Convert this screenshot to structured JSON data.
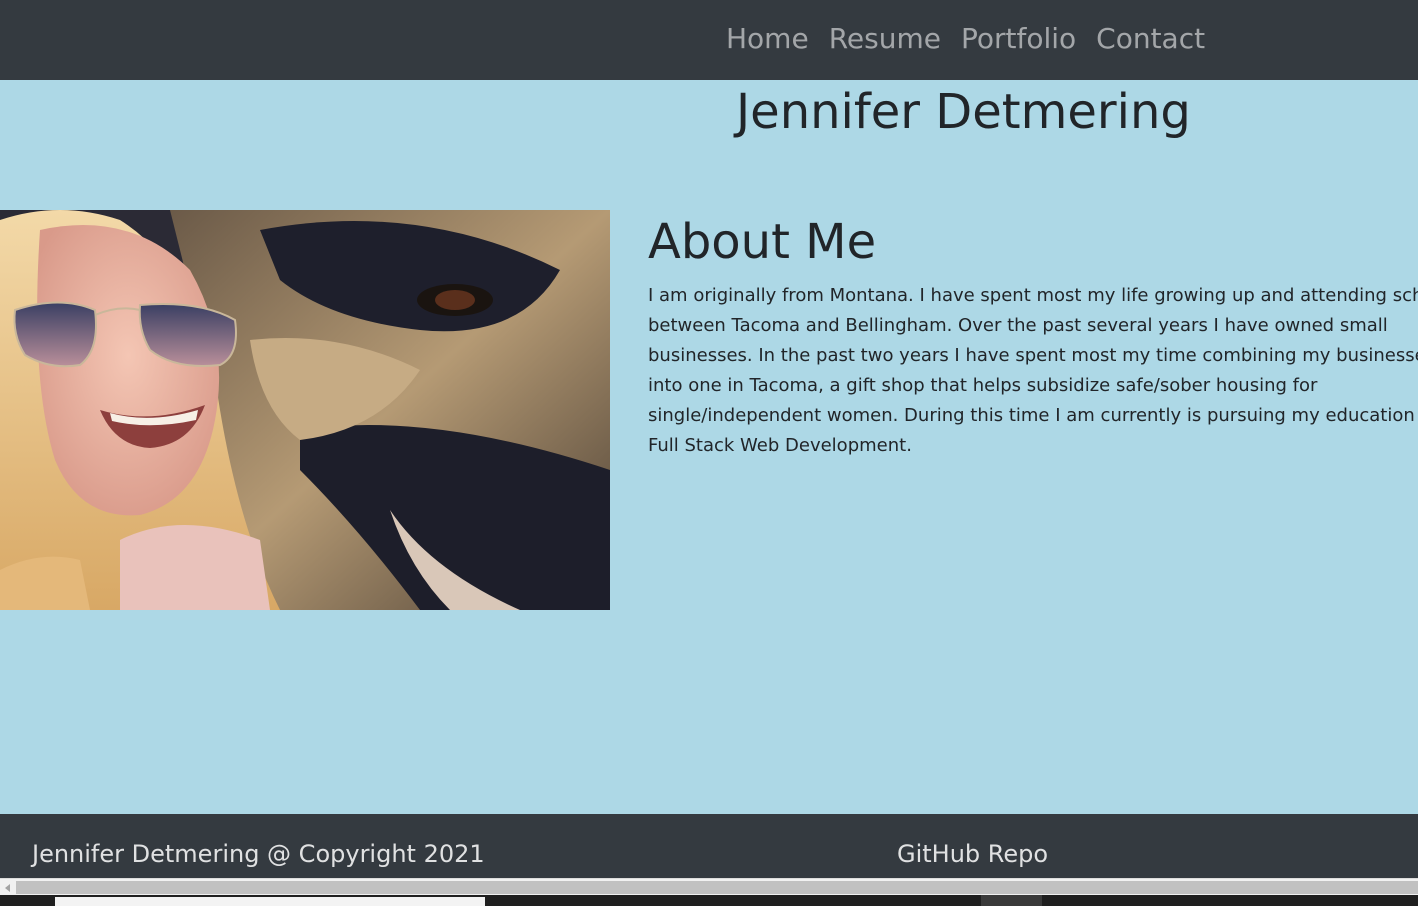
{
  "nav": {
    "items": [
      {
        "label": "Home"
      },
      {
        "label": "Resume"
      },
      {
        "label": "Portfolio"
      },
      {
        "label": "Contact"
      }
    ]
  },
  "header": {
    "title": "Jennifer Detmering"
  },
  "about": {
    "heading": "About Me",
    "body": "I am originally from Montana. I have spent most my life growing up and attending school between Tacoma and Bellingham. Over the past several years I have owned small businesses. In the past two years I have spent most my time combining my businesses into one in Tacoma, a gift shop that helps subsidize safe/sober housing for single/independent women. During this time I am currently is pursuing my education in Full Stack Web Development."
  },
  "photo": {
    "icon": "profile-photo-woman-with-dog"
  },
  "footer": {
    "copyright": "Jennifer Detmering @ Copyright 2021",
    "repo_link": "GitHub Repo"
  },
  "colors": {
    "navbar_bg": "#343a40",
    "main_bg": "#add8e6",
    "text": "#212529",
    "nav_link": "rgba(255,255,255,0.55)"
  }
}
